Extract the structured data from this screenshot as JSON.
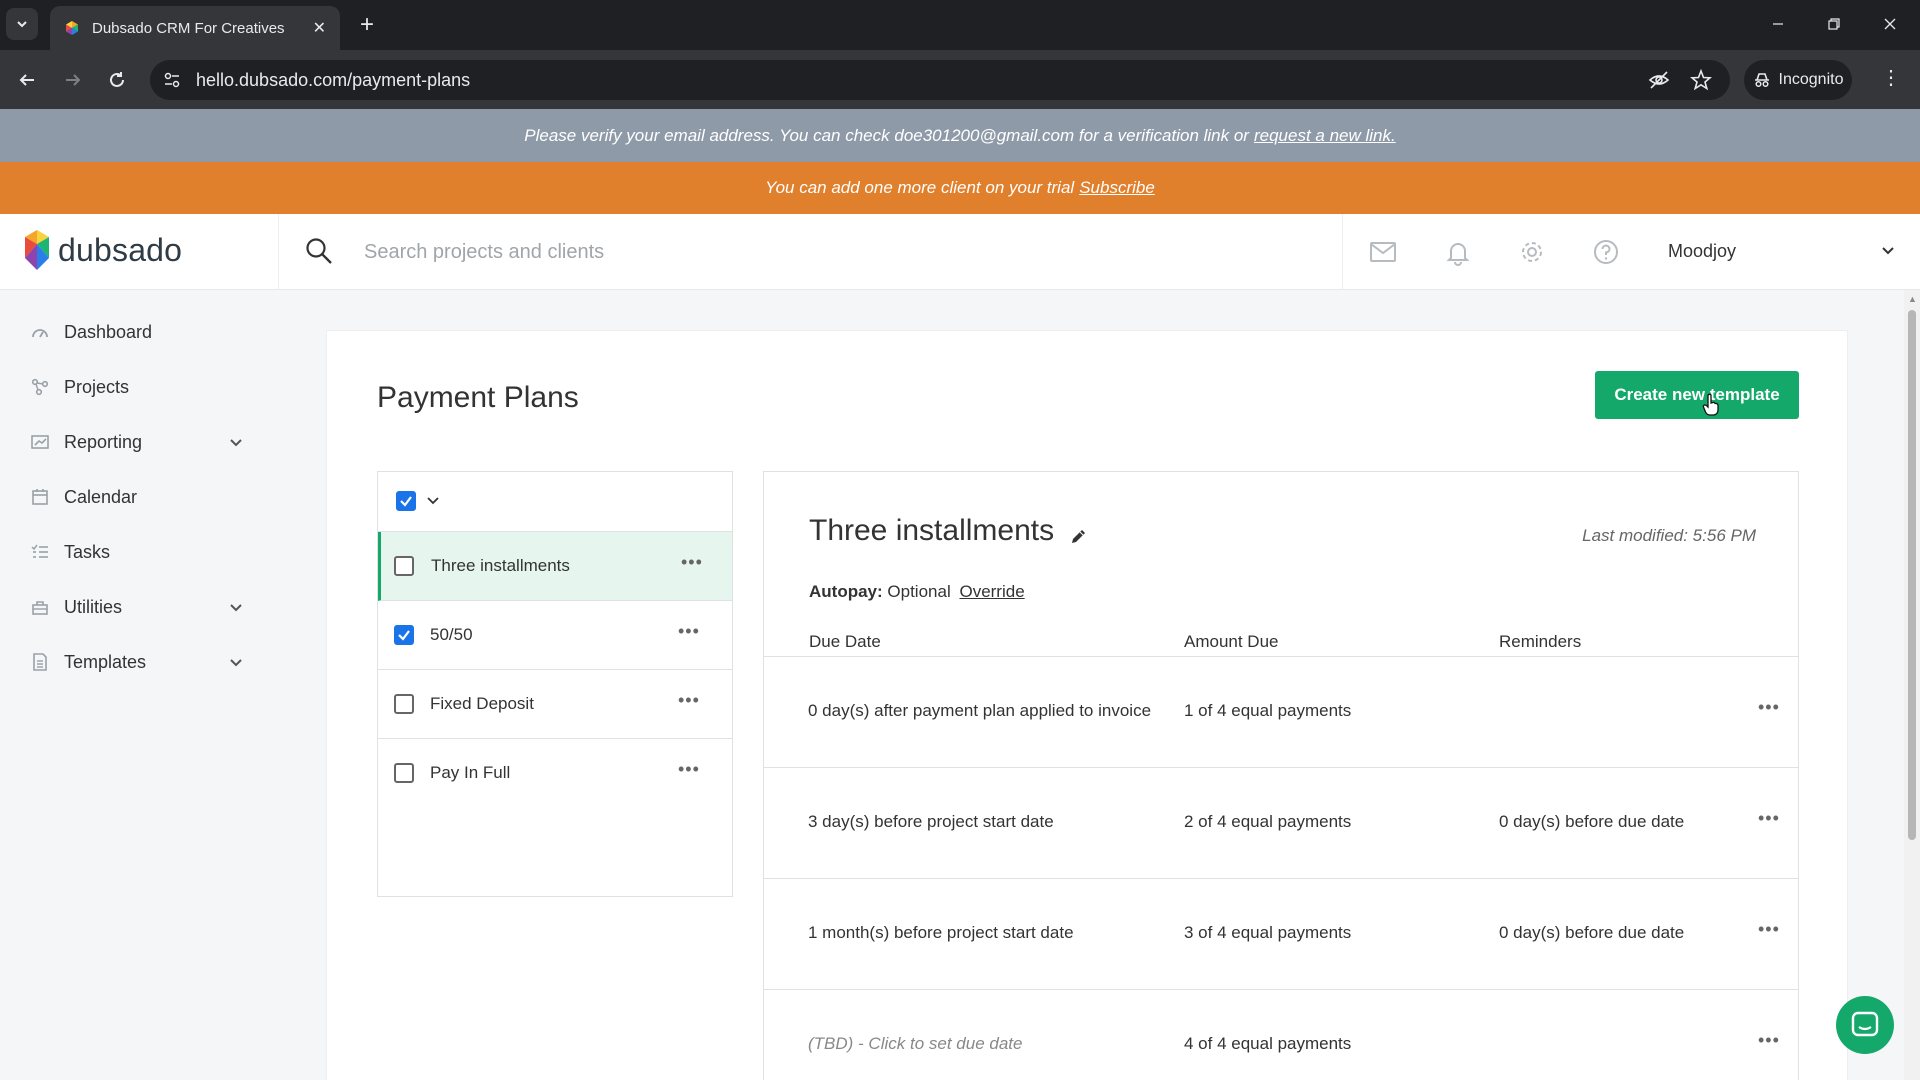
{
  "browser": {
    "tab_title": "Dubsado CRM For Creatives",
    "url": "hello.dubsado.com/payment-plans",
    "incognito_label": "Incognito"
  },
  "banners": {
    "verify_text": "Please verify your email address. You can check doe301200@gmail.com for a verification link or",
    "verify_link": "request a new link.",
    "trial_text": "You can add one more client on your trial",
    "trial_link": "Subscribe"
  },
  "header": {
    "logo_text": "dubsado",
    "search_placeholder": "Search projects and clients",
    "user_name": "Moodjoy",
    "icons": [
      "mail-icon",
      "bell-icon",
      "gear-icon",
      "help-icon"
    ]
  },
  "sidebar": {
    "items": [
      {
        "label": "Dashboard",
        "icon": "dashboard-icon",
        "has_chevron": false
      },
      {
        "label": "Projects",
        "icon": "projects-icon",
        "has_chevron": false
      },
      {
        "label": "Reporting",
        "icon": "reporting-icon",
        "has_chevron": true
      },
      {
        "label": "Calendar",
        "icon": "calendar-icon",
        "has_chevron": false
      },
      {
        "label": "Tasks",
        "icon": "tasks-icon",
        "has_chevron": false
      },
      {
        "label": "Utilities",
        "icon": "utilities-icon",
        "has_chevron": true
      },
      {
        "label": "Templates",
        "icon": "templates-icon",
        "has_chevron": true
      }
    ]
  },
  "main": {
    "page_title": "Payment Plans",
    "create_button": "Create new template",
    "plans": [
      {
        "name": "Three installments",
        "checked": false,
        "active": true
      },
      {
        "name": "50/50",
        "checked": true,
        "active": false
      },
      {
        "name": "Fixed Deposit",
        "checked": false,
        "active": false
      },
      {
        "name": "Pay In Full",
        "checked": false,
        "active": false
      }
    ],
    "detail": {
      "title": "Three installments",
      "last_modified": "Last modified: 5:56 PM",
      "autopay_label": "Autopay:",
      "autopay_value": "Optional",
      "autopay_override": "Override",
      "columns": [
        "Due Date",
        "Amount Due",
        "Reminders"
      ],
      "rows": [
        {
          "due": "0 day(s) after payment plan applied to invoice",
          "amount": "1 of 4 equal payments",
          "reminder": ""
        },
        {
          "due": "3 day(s) before project start date",
          "amount": "2 of 4 equal payments",
          "reminder": "0 day(s) before due date"
        },
        {
          "due": "1 month(s) before project start date",
          "amount": "3 of 4 equal payments",
          "reminder": "0 day(s) before due date"
        },
        {
          "due": "(TBD) - Click to set due date",
          "amount": "4 of 4 equal payments",
          "reminder": ""
        }
      ]
    }
  },
  "colors": {
    "brand_green": "#14a86b",
    "trial_orange": "#e07f2c",
    "verify_gray": "#8e9aa8"
  }
}
